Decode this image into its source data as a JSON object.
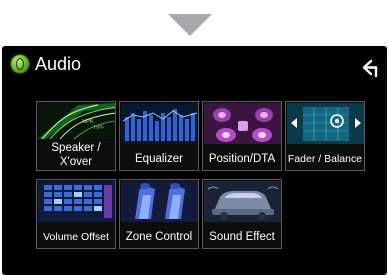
{
  "header": {
    "title": "Audio"
  },
  "tiles": [
    {
      "label": "Speaker /\nX'over",
      "icon": "speaker-crossover-thumbnail"
    },
    {
      "label": "Equalizer",
      "icon": "equalizer-thumbnail"
    },
    {
      "label": "Position/DTA",
      "icon": "position-dta-thumbnail"
    },
    {
      "label": "Fader / Balance",
      "icon": "fader-balance-thumbnail"
    },
    {
      "label": "Volume Offset",
      "icon": "volume-offset-thumbnail"
    },
    {
      "label": "Zone Control",
      "icon": "zone-control-thumbnail"
    },
    {
      "label": "Sound Effect",
      "icon": "sound-effect-thumbnail"
    }
  ],
  "colors": {
    "screen_bg": "#000000",
    "tile_border": "#5a5a5a",
    "text": "#ffffff",
    "arrow": "#a7a9ac"
  }
}
